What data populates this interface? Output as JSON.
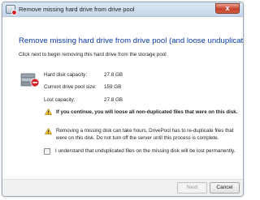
{
  "window": {
    "title": "Remove missing hard drive from drive pool",
    "close_label": "x"
  },
  "content": {
    "heading": "Remove missing hard drive from drive pool (and loose unduplicated files)",
    "subtext": "Click next to begin removing this hard drive from the storage pool"
  },
  "info": [
    {
      "label": "Hard disk capacity:",
      "value": "27.8 GB"
    },
    {
      "label": "Current drive pool size:",
      "value": "159 GB"
    },
    {
      "label": "Lost capacity:",
      "value": "27.8 GB"
    }
  ],
  "warnings": [
    {
      "text": "If you continue, you will loose all non-duplicated files that were on this disk.",
      "icon": "warning-icon"
    },
    {
      "text": "Removing a missing disk can take hours. DrivePool has to re-duplicate files that were on this disk. Do not turn off the server until this process is complete.",
      "icon": "warning-icon"
    }
  ],
  "confirm": {
    "label": "I understand that unduplicated files on the missing disk will be lost permanently.",
    "checked": false
  },
  "buttons": {
    "next": "Next",
    "cancel": "Cancel"
  },
  "colors": {
    "heading": "#0a3ca6",
    "warning": "#f2c12e",
    "error": "#d0242a"
  }
}
